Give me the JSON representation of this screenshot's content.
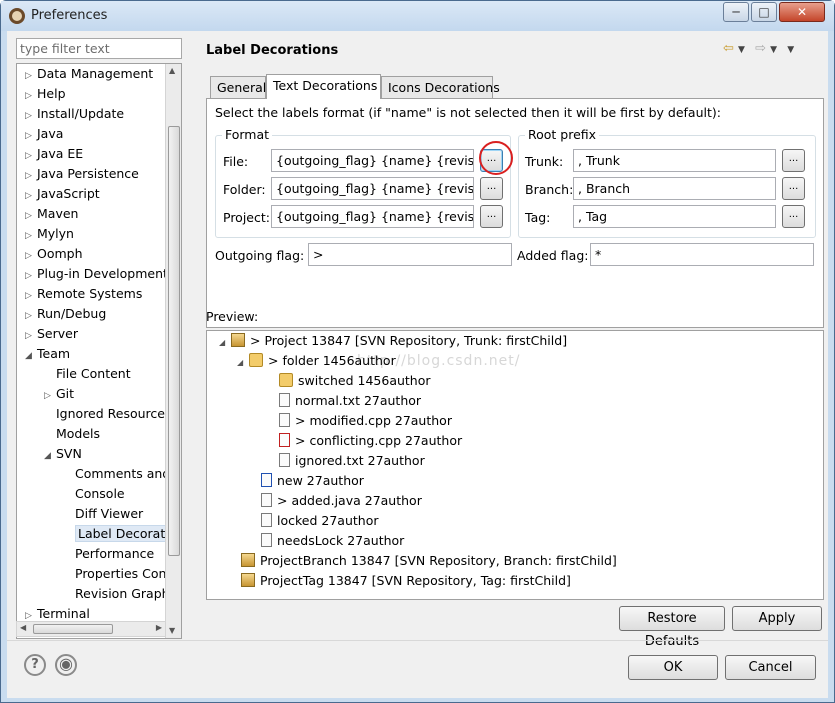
{
  "window": {
    "title": "Preferences",
    "minimize": "─",
    "maximize": "□",
    "close": "✕"
  },
  "sidebar": {
    "filter_placeholder": "type filter text",
    "items": [
      {
        "label": "Data Management",
        "twisty": "▷",
        "level": 0
      },
      {
        "label": "Help",
        "twisty": "▷",
        "level": 0
      },
      {
        "label": "Install/Update",
        "twisty": "▷",
        "level": 0
      },
      {
        "label": "Java",
        "twisty": "▷",
        "level": 0
      },
      {
        "label": "Java EE",
        "twisty": "▷",
        "level": 0
      },
      {
        "label": "Java Persistence",
        "twisty": "▷",
        "level": 0
      },
      {
        "label": "JavaScript",
        "twisty": "▷",
        "level": 0
      },
      {
        "label": "Maven",
        "twisty": "▷",
        "level": 0
      },
      {
        "label": "Mylyn",
        "twisty": "▷",
        "level": 0
      },
      {
        "label": "Oomph",
        "twisty": "▷",
        "level": 0
      },
      {
        "label": "Plug-in Development",
        "twisty": "▷",
        "level": 0
      },
      {
        "label": "Remote Systems",
        "twisty": "▷",
        "level": 0
      },
      {
        "label": "Run/Debug",
        "twisty": "▷",
        "level": 0
      },
      {
        "label": "Server",
        "twisty": "▷",
        "level": 0
      },
      {
        "label": "Team",
        "twisty": "◢",
        "level": 0
      },
      {
        "label": "File Content",
        "twisty": "",
        "level": 1
      },
      {
        "label": "Git",
        "twisty": "▷",
        "level": 1
      },
      {
        "label": "Ignored Resources",
        "twisty": "",
        "level": 1
      },
      {
        "label": "Models",
        "twisty": "",
        "level": 1
      },
      {
        "label": "SVN",
        "twisty": "◢",
        "level": 1
      },
      {
        "label": "Comments and",
        "twisty": "",
        "level": 2
      },
      {
        "label": "Console",
        "twisty": "",
        "level": 2
      },
      {
        "label": "Diff Viewer",
        "twisty": "",
        "level": 2
      },
      {
        "label": "Label Decorations",
        "twisty": "",
        "level": 2,
        "selected": true
      },
      {
        "label": "Performance",
        "twisty": "",
        "level": 2
      },
      {
        "label": "Properties Con",
        "twisty": "",
        "level": 2
      },
      {
        "label": "Revision Graph",
        "twisty": "",
        "level": 2
      },
      {
        "label": "Terminal",
        "twisty": "▷",
        "level": 0
      }
    ]
  },
  "page": {
    "title": "Label Decorations",
    "tabs": [
      "General",
      "Text Decorations",
      "Icons Decorations"
    ],
    "instruction": "Select the labels format (if \"name\" is not selected then it will be first by default):",
    "format": {
      "title": "Format",
      "file_label": "File:",
      "file_value": "{outgoing_flag} {name} {revision}{author}",
      "folder_label": "Folder:",
      "folder_value": "{outgoing_flag} {name} {revision}{author}",
      "project_label": "Project:",
      "project_value": "{outgoing_flag} {name} {revision} [{location_label}]",
      "browse": "..."
    },
    "root_prefix": {
      "title": "Root prefix",
      "trunk_label": "Trunk:",
      "trunk_value": ", Trunk",
      "branch_label": "Branch:",
      "branch_value": ", Branch",
      "tag_label": "Tag:",
      "tag_value": ", Tag"
    },
    "outgoing_label": "Outgoing flag:",
    "outgoing_value": ">",
    "added_label": "Added flag:",
    "added_value": "*",
    "preview_label": "Preview:",
    "preview": [
      {
        "text": "> Project 13847 [SVN Repository, Trunk: firstChild]",
        "icon": "repo",
        "twisty": "◢"
      },
      {
        "text": "> folder 1456author",
        "icon": "folder",
        "twisty": "◢"
      },
      {
        "text": "switched 1456author",
        "icon": "folder",
        "twisty": ""
      },
      {
        "text": "normal.txt 27author",
        "icon": "file",
        "twisty": ""
      },
      {
        "text": "> modified.cpp 27author",
        "icon": "file",
        "twisty": ""
      },
      {
        "text": "> conflicting.cpp 27author",
        "icon": "file-red",
        "twisty": ""
      },
      {
        "text": "ignored.txt 27author",
        "icon": "file",
        "twisty": ""
      },
      {
        "text": "new 27author",
        "icon": "file-blue",
        "twisty": ""
      },
      {
        "text": "> added.java 27author",
        "icon": "file",
        "twisty": ""
      },
      {
        "text": "locked 27author",
        "icon": "file",
        "twisty": ""
      },
      {
        "text": "needsLock 27author",
        "icon": "file",
        "twisty": ""
      },
      {
        "text": "ProjectBranch 13847 [SVN Repository, Branch: firstChild]",
        "icon": "repo",
        "twisty": ""
      },
      {
        "text": "ProjectTag 13847 [SVN Repository, Tag: firstChild]",
        "icon": "repo",
        "twisty": ""
      }
    ],
    "watermark": "http://blog.csdn.net/",
    "restore_defaults": "Restore Defaults",
    "apply": "Apply"
  },
  "footer": {
    "help": "?",
    "ok": "OK",
    "cancel": "Cancel"
  },
  "colors": {
    "accent": "#3c7fb1",
    "highlight_circle": "#d92020",
    "titlebar": "#c3d8ee"
  }
}
